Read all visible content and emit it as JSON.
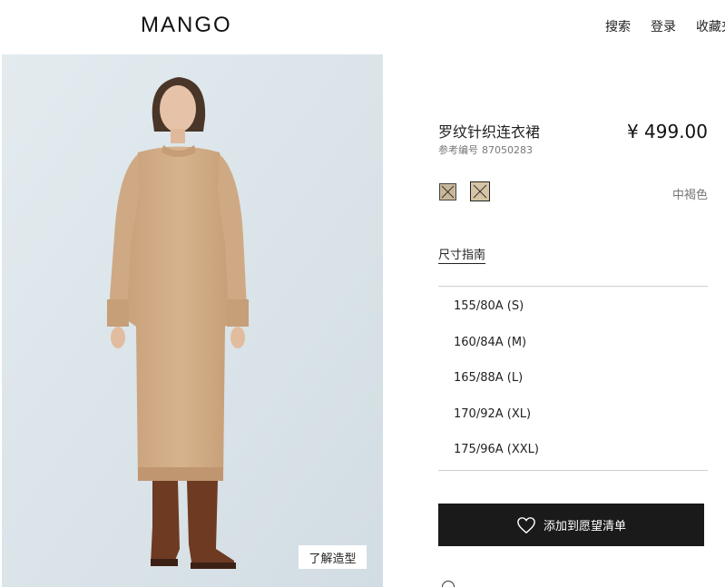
{
  "header": {
    "logo": "MANGO",
    "nav": [
      "搜索",
      "登录",
      "收藏夹"
    ]
  },
  "product": {
    "name": "罗纹针织连衣裙",
    "ref_label": "参考编号",
    "ref_number": "87050283",
    "price": "¥ 499.00",
    "color_name": "中褐色",
    "size_guide": "尺寸指南",
    "sizes": [
      "155/80A (S)",
      "160/84A (M)",
      "165/88A (L)",
      "170/92A (XL)",
      "175/96A (XXL)"
    ],
    "wishlist_button": "添加到愿望清单",
    "look_button": "了解造型"
  },
  "colors": {
    "button_bg": "#1a1a1a",
    "photo_bg": "#dde6ea",
    "swatch_1": "#c9b79a",
    "swatch_2": "#d7c4a5"
  },
  "icons": [
    "heart-icon",
    "info-icon"
  ]
}
